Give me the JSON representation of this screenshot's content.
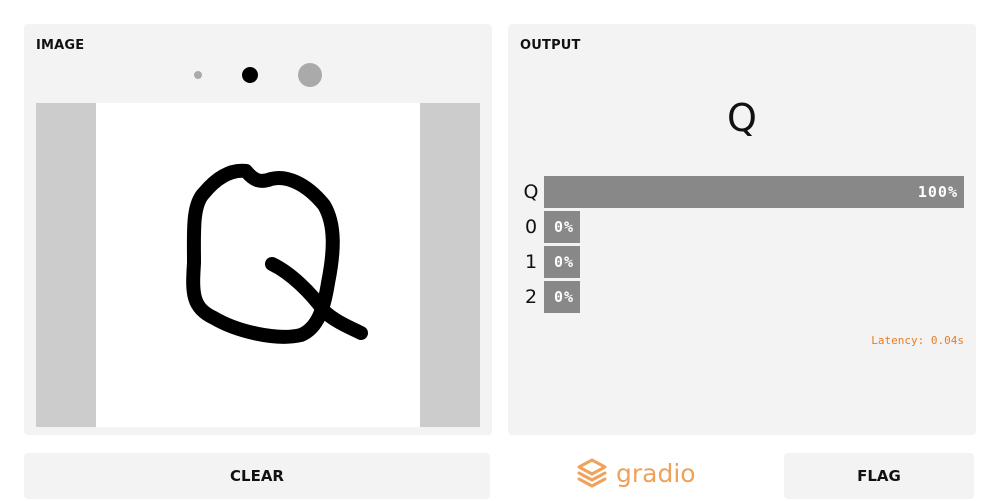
{
  "input": {
    "title": "IMAGE",
    "brush_sizes": [
      "small",
      "medium",
      "large"
    ],
    "selected_brush": "medium"
  },
  "output": {
    "title": "OUTPUT",
    "prediction": "Q",
    "confidences": [
      {
        "label": "Q",
        "value": 1.0,
        "display": "100%"
      },
      {
        "label": "0",
        "value": 0.0,
        "display": "0%"
      },
      {
        "label": "1",
        "value": 0.0,
        "display": "0%"
      },
      {
        "label": "2",
        "value": 0.0,
        "display": "0%"
      }
    ],
    "latency": "Latency: 0.04s"
  },
  "buttons": {
    "clear_label": "CLEAR",
    "flag_label": "FLAG"
  },
  "branding": {
    "logo_text": "gradio",
    "logo_color": "#f0a15a"
  },
  "colors": {
    "panel_bg": "#f3f3f3",
    "bar_color": "#888888",
    "latency_color": "#e67e22"
  }
}
